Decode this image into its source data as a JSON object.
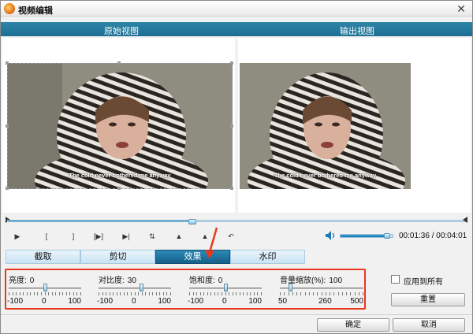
{
  "window": {
    "title": "视频编辑",
    "close_glyph": "✕"
  },
  "views": {
    "original_label": "原始视图",
    "output_label": "输出视图",
    "subtitle_text": "The cold never bothered me anyway"
  },
  "playback": {
    "progress_fraction": 0.404,
    "volume_fraction": 0.9,
    "current_time": "00:01:36",
    "total_time": "00:04:01",
    "time_separator": " / "
  },
  "controls": [
    {
      "name": "play-button",
      "glyph": "▶"
    },
    {
      "name": "mark-in-button",
      "glyph": "["
    },
    {
      "name": "mark-out-button",
      "glyph": "]"
    },
    {
      "name": "play-selection-button",
      "glyph": "[▶]"
    },
    {
      "name": "next-frame-button",
      "glyph": "▶|"
    },
    {
      "name": "flip-vertical-button",
      "glyph": "⇅"
    },
    {
      "name": "flip-horizontal-button",
      "glyph": "▲"
    },
    {
      "name": "mirror-button",
      "glyph": "▲"
    },
    {
      "name": "undo-button",
      "glyph": "↶"
    }
  ],
  "tabs": [
    {
      "label": "截取",
      "active": false
    },
    {
      "label": "剪切",
      "active": false
    },
    {
      "label": "效果",
      "active": true
    },
    {
      "label": "水印",
      "active": false
    }
  ],
  "sliders": [
    {
      "label": "亮度:",
      "value": "0",
      "min_label": "-100",
      "mid_label": "0",
      "max_label": "100",
      "fraction": 0.5
    },
    {
      "label": "对比度:",
      "value": "30",
      "min_label": "-100",
      "mid_label": "0",
      "max_label": "100",
      "fraction": 0.6
    },
    {
      "label": "饱和度:",
      "value": "0",
      "min_label": "-100",
      "mid_label": "0",
      "max_label": "100",
      "fraction": 0.5
    },
    {
      "label": "音量缩放(%):",
      "value": "100",
      "min_label": "50",
      "mid_label": "260",
      "max_label": "500",
      "fraction": 0.11
    }
  ],
  "apply_all_label": "应用到所有",
  "reset_label": "重置",
  "ok_label": "确定",
  "cancel_label": "取消",
  "colors": {
    "accent": "#1b6e92",
    "highlight": "#e8391c"
  }
}
